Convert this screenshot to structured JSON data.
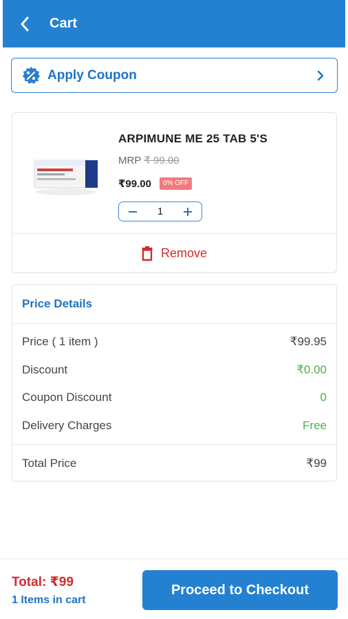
{
  "header": {
    "title": "Cart",
    "back_icon": "back-arrow-icon"
  },
  "coupon": {
    "label": "Apply Coupon",
    "icon": "discount-badge-icon",
    "chevron": "chevron-right-icon"
  },
  "item": {
    "name": "ARPIMUNE ME 25 TAB 5'S",
    "mrp_label": "MRP",
    "mrp_value": "₹ 99.00",
    "price": "₹99.00",
    "discount_badge": "0% OFF",
    "quantity": "1",
    "remove_label": "Remove",
    "remove_icon": "trash-icon"
  },
  "price_details": {
    "title": "Price Details",
    "rows": [
      {
        "label": "Price ( 1 item )",
        "value": "₹99.95"
      },
      {
        "label": "Discount",
        "value": "₹0.00"
      },
      {
        "label": "Coupon Discount",
        "value": "0"
      },
      {
        "label": "Delivery Charges",
        "value": "Free"
      }
    ],
    "total_label": "Total Price",
    "total_value": "₹99"
  },
  "footer": {
    "total_text": "Total: ₹99",
    "items_text": "1 Items in cart",
    "checkout_label": "Proceed to Checkout"
  },
  "colors": {
    "primary": "#2481d2",
    "danger": "#d6292f",
    "success": "#4caf50",
    "badge": "#f07b7e"
  }
}
